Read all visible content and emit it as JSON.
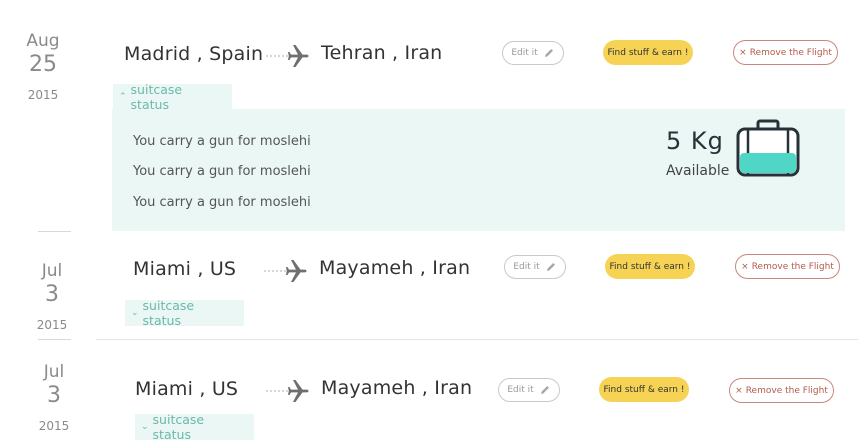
{
  "flights": [
    {
      "date": {
        "month": "Aug",
        "day": "25",
        "year": "2015"
      },
      "from": "Madrid , Spain",
      "to": "Tehran , Iran",
      "edit_label": "Edit it",
      "find_label": "Find stuff & earn !",
      "remove_label": "Remove the Flight",
      "suitcase_tab": "suitcase status",
      "tab_state": "expanded",
      "suitcase": {
        "items": [
          "You carry a gun for moslehi",
          "You carry a gun for moslehi",
          "You carry a gun for moslehi"
        ],
        "weight": "5 Kg",
        "available_label": "Available"
      }
    },
    {
      "date": {
        "month": "Jul",
        "day": "3",
        "year": "2015"
      },
      "from": "Miami , US",
      "to": "Mayameh , Iran",
      "edit_label": "Edit it",
      "find_label": "Find stuff & earn !",
      "remove_label": "Remove the Flight",
      "suitcase_tab": "suitcase status",
      "tab_state": "collapsed"
    },
    {
      "date": {
        "month": "Jul",
        "day": "3",
        "year": "2015"
      },
      "from": "Miami , US",
      "to": "Mayameh , Iran",
      "edit_label": "Edit it",
      "find_label": "Find stuff & earn !",
      "remove_label": "Remove the Flight",
      "suitcase_tab": "suitcase status",
      "tab_state": "collapsed"
    }
  ],
  "icons": {
    "plane": "airplane-icon",
    "edit": "pencil-icon",
    "remove": "close-icon",
    "collapse": "chevron-up-icon",
    "expand": "chevron-down-icon",
    "suitcase": "suitcase-icon"
  },
  "colors": {
    "accent_yellow": "#f7d355",
    "panel_bg": "#eaf7f5",
    "teal": "#4fd6c6",
    "remove_border": "#c9877c"
  }
}
